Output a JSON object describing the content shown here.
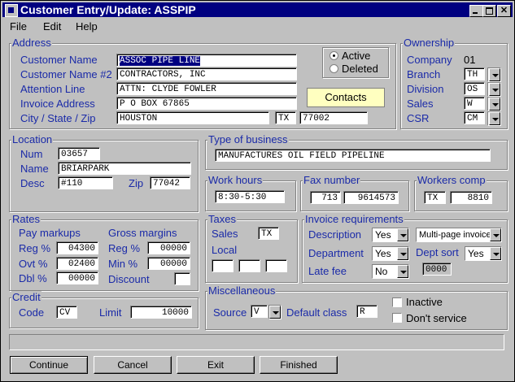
{
  "window": {
    "title": "Customer Entry/Update:  ASSPIP"
  },
  "menu": {
    "file": "File",
    "edit": "Edit",
    "help": "Help"
  },
  "address": {
    "title": "Address",
    "customer_name_label": "Customer Name",
    "customer_name": "ASSOC PIPE LINE",
    "customer_name2_label": "Customer Name #2",
    "customer_name2": "CONTRACTORS, INC",
    "attention_label": "Attention Line",
    "attention": "ATTN: CLYDE FOWLER",
    "invoice_label": "Invoice Address",
    "invoice": "P O BOX 67865",
    "csz_label": "City / State / Zip",
    "city": "HOUSTON",
    "state": "TX",
    "zip": "77002",
    "active_label": "Active",
    "deleted_label": "Deleted",
    "contacts_label": "Contacts"
  },
  "ownership": {
    "title": "Ownership",
    "company_label": "Company",
    "company": "01",
    "branch_label": "Branch",
    "branch": "TH",
    "division_label": "Division",
    "division": "OS",
    "sales_label": "Sales",
    "sales": "W",
    "csr_label": "CSR",
    "csr": "CM"
  },
  "location": {
    "title": "Location",
    "num_label": "Num",
    "num": "03657",
    "name_label": "Name",
    "name": "BRIARPARK",
    "desc_label": "Desc",
    "desc": "#110",
    "zip_label": "Zip",
    "zip": "77042"
  },
  "business": {
    "title": "Type of business",
    "value": "MANUFACTURES OIL FIELD PIPELINE"
  },
  "work_hours": {
    "title": "Work hours",
    "value": "8:30-5:30"
  },
  "fax": {
    "title": "Fax number",
    "area": "713",
    "number": "9614573"
  },
  "workers_comp": {
    "title": "Workers comp",
    "state": "TX",
    "code": "8810"
  },
  "rates": {
    "title": "Rates",
    "pay_markups": "Pay markups",
    "gross_margins": "Gross margins",
    "reg_label": "Reg %",
    "reg": "04300",
    "ovt_label": "Ovt %",
    "ovt": "02400",
    "dbl_label": "Dbl %",
    "dbl": "00000",
    "gm_reg_label": "Reg %",
    "gm_reg": "00000",
    "min_label": "Min %",
    "min": "00000",
    "discount_label": "Discount",
    "discount": ""
  },
  "taxes": {
    "title": "Taxes",
    "sales_label": "Sales",
    "sales": "TX",
    "local_label": "Local"
  },
  "invoice_req": {
    "title": "Invoice requirements",
    "description_label": "Description",
    "description": "Yes",
    "multipage": "Multi-page invoice",
    "department_label": "Department",
    "department": "Yes",
    "dept_sort_label": "Dept sort",
    "dept_sort": "Yes",
    "late_fee_label": "Late fee",
    "late_fee": "No",
    "code": "0000"
  },
  "credit": {
    "title": "Credit",
    "code_label": "Code",
    "code": "CV",
    "limit_label": "Limit",
    "limit": "10000"
  },
  "misc": {
    "title": "Miscellaneous",
    "source_label": "Source",
    "source": "V",
    "default_class_label": "Default class",
    "default_class": "R",
    "inactive_label": "Inactive",
    "dont_service_label": "Don't service"
  },
  "buttons": {
    "continue": "Continue",
    "cancel": "Cancel",
    "exit": "Exit",
    "finished": "Finished"
  }
}
